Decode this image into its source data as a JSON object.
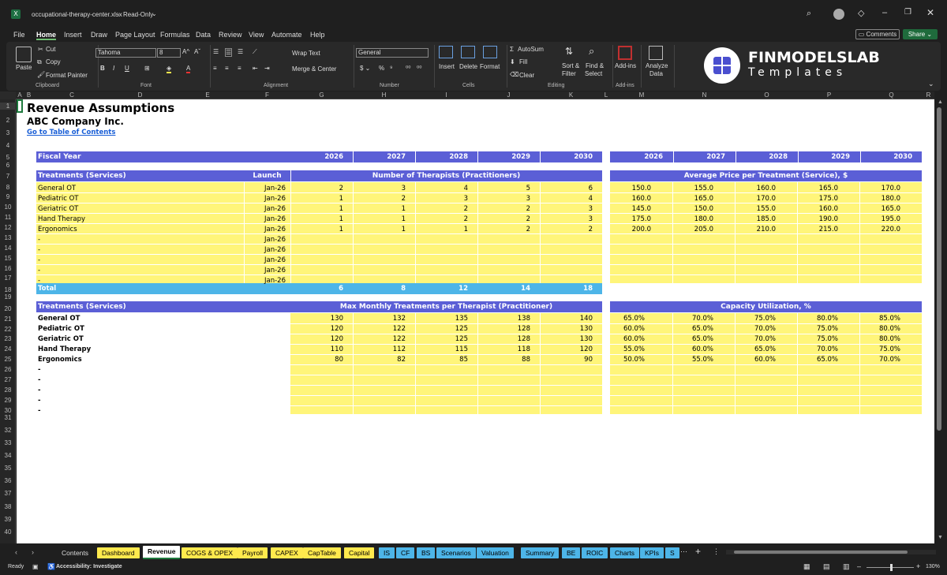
{
  "window": {
    "filename": "occupational-therapy-center.xlsx",
    "mode": "Read-Only"
  },
  "menu": [
    "File",
    "Home",
    "Insert",
    "Draw",
    "Page Layout",
    "Formulas",
    "Data",
    "Review",
    "View",
    "Automate",
    "Help"
  ],
  "top_right": {
    "comments": "Comments",
    "share": "Share"
  },
  "ribbon": {
    "paste": "Paste",
    "cut": "Cut",
    "copy": "Copy",
    "format_painter": "Format Painter",
    "clipboard": "Clipboard",
    "font_name": "Tahoma",
    "font_size": "8",
    "font_group": "Font",
    "wrap_text": "Wrap Text",
    "merge_center": "Merge & Center",
    "alignment": "Alignment",
    "number_format": "General",
    "number": "Number",
    "insert": "Insert",
    "delete": "Delete",
    "format": "Format",
    "cells": "Cells",
    "autosum": "AutoSum",
    "fill": "Fill",
    "clear": "Clear",
    "sort_filter": "Sort &",
    "sort_filter2": "Filter",
    "find_select": "Find &",
    "find_select2": "Select",
    "editing": "Editing",
    "addins": "Add-ins",
    "addins_group": "Add-ins",
    "analyze": "Analyze",
    "analyze2": "Data"
  },
  "brand": {
    "name": "FINMODELSLAB",
    "sub": "Templates"
  },
  "columns": [
    "A",
    "B",
    "C",
    "D",
    "E",
    "F",
    "G",
    "H",
    "I",
    "J",
    "K",
    "L",
    "M",
    "N",
    "O",
    "P",
    "Q",
    "R"
  ],
  "rows": [
    "1",
    "2",
    "3",
    "4",
    "5",
    "6",
    "7",
    "8",
    "9",
    "10",
    "11",
    "12",
    "13",
    "14",
    "15",
    "16",
    "17",
    "18",
    "19",
    "20",
    "21",
    "22",
    "23",
    "24",
    "25",
    "26",
    "27",
    "28",
    "29",
    "30",
    "31",
    "32",
    "33",
    "34",
    "35",
    "36",
    "37",
    "38",
    "39",
    "40"
  ],
  "sheet": {
    "title": "Revenue Assumptions",
    "company": "ABC Company Inc.",
    "toc_link": "Go to Table of Contents",
    "fiscal_year": "Fiscal Year",
    "years": [
      "2026",
      "2027",
      "2028",
      "2029",
      "2030"
    ],
    "t1_header": "Treatments (Services)",
    "launch_header": "Launch",
    "therapists_header": "Number of Therapists (Practitioners)",
    "price_header": "Average Price per Treatment (Service), $",
    "services": [
      "General OT",
      "Pediatric OT",
      "Geriatric OT",
      "Hand Therapy",
      "Ergonomics",
      "-",
      "-",
      "-",
      "-",
      "-"
    ],
    "launch": [
      "Jan-26",
      "Jan-26",
      "Jan-26",
      "Jan-26",
      "Jan-26",
      "Jan-26",
      "Jan-26",
      "Jan-26",
      "Jan-26",
      "Jan-26"
    ],
    "therapists": [
      [
        "2",
        "3",
        "4",
        "5",
        "6"
      ],
      [
        "1",
        "2",
        "3",
        "3",
        "4"
      ],
      [
        "1",
        "1",
        "2",
        "2",
        "3"
      ],
      [
        "1",
        "1",
        "2",
        "2",
        "3"
      ],
      [
        "1",
        "1",
        "1",
        "2",
        "2"
      ]
    ],
    "prices": [
      [
        "150.0",
        "155.0",
        "160.0",
        "165.0",
        "170.0"
      ],
      [
        "160.0",
        "165.0",
        "170.0",
        "175.0",
        "180.0"
      ],
      [
        "145.0",
        "150.0",
        "155.0",
        "160.0",
        "165.0"
      ],
      [
        "175.0",
        "180.0",
        "185.0",
        "190.0",
        "195.0"
      ],
      [
        "200.0",
        "205.0",
        "210.0",
        "215.0",
        "220.0"
      ]
    ],
    "total_label": "Total",
    "totals": [
      "6",
      "8",
      "12",
      "14",
      "18"
    ],
    "t2_header": "Treatments (Services)",
    "max_header": "Max Monthly Treatments per Therapist (Practitioner)",
    "cap_header": "Capacity Utilization, %",
    "max_treatments": [
      [
        "130",
        "132",
        "135",
        "138",
        "140"
      ],
      [
        "120",
        "122",
        "125",
        "128",
        "130"
      ],
      [
        "120",
        "122",
        "125",
        "128",
        "130"
      ],
      [
        "110",
        "112",
        "115",
        "118",
        "120"
      ],
      [
        "80",
        "82",
        "85",
        "88",
        "90"
      ]
    ],
    "capacity": [
      [
        "65.0%",
        "70.0%",
        "75.0%",
        "80.0%",
        "85.0%"
      ],
      [
        "60.0%",
        "65.0%",
        "70.0%",
        "75.0%",
        "80.0%"
      ],
      [
        "60.0%",
        "65.0%",
        "70.0%",
        "75.0%",
        "80.0%"
      ],
      [
        "55.0%",
        "60.0%",
        "65.0%",
        "70.0%",
        "75.0%"
      ],
      [
        "50.0%",
        "55.0%",
        "60.0%",
        "65.0%",
        "70.0%"
      ]
    ]
  },
  "tabs": [
    {
      "label": "Contents",
      "color": "#1f1f1f",
      "text": "#ddd"
    },
    {
      "label": "Dashboard",
      "color": "#ffe94d",
      "text": "#000"
    },
    {
      "label": "Revenue",
      "color": "#ffffff",
      "text": "#000"
    },
    {
      "label": "COGS & OPEX",
      "color": "#ffe94d",
      "text": "#000"
    },
    {
      "label": "Payroll",
      "color": "#ffe94d",
      "text": "#000"
    },
    {
      "label": "CAPEX",
      "color": "#ffe94d",
      "text": "#000"
    },
    {
      "label": "CapTable",
      "color": "#ffe94d",
      "text": "#000"
    },
    {
      "label": "Capital",
      "color": "#ffe94d",
      "text": "#000"
    },
    {
      "label": "IS",
      "color": "#4db5e8",
      "text": "#000"
    },
    {
      "label": "CF",
      "color": "#4db5e8",
      "text": "#000"
    },
    {
      "label": "BS",
      "color": "#4db5e8",
      "text": "#000"
    },
    {
      "label": "Scenarios",
      "color": "#4db5e8",
      "text": "#000"
    },
    {
      "label": "Valuation",
      "color": "#4db5e8",
      "text": "#000"
    },
    {
      "label": "Summary",
      "color": "#4db5e8",
      "text": "#000"
    },
    {
      "label": "BE",
      "color": "#4db5e8",
      "text": "#000"
    },
    {
      "label": "ROIC",
      "color": "#4db5e8",
      "text": "#000"
    },
    {
      "label": "Charts",
      "color": "#4db5e8",
      "text": "#000"
    },
    {
      "label": "KPIs",
      "color": "#4db5e8",
      "text": "#000"
    },
    {
      "label": "S",
      "color": "#4db5e8",
      "text": "#000"
    }
  ],
  "status": {
    "ready": "Ready",
    "accessibility": "Accessibility: Investigate",
    "zoom": "130%"
  }
}
